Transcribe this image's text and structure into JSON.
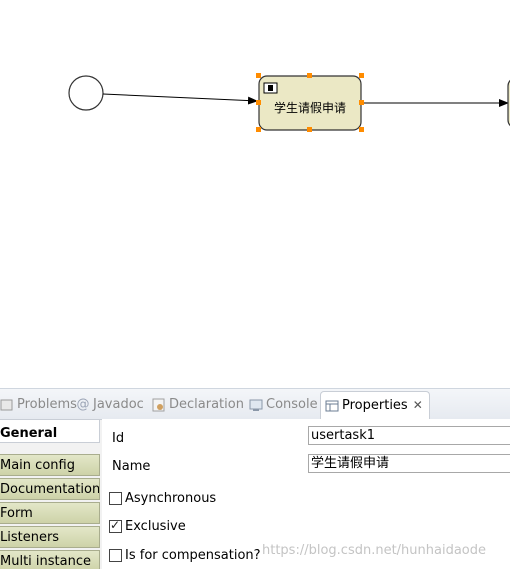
{
  "diagram": {
    "task_label": "学生请假申请"
  },
  "tabs": [
    {
      "label": "Problems",
      "icon": "problems-icon",
      "active": false
    },
    {
      "label": "Javadoc",
      "icon": "at-icon",
      "active": false
    },
    {
      "label": "Declaration",
      "icon": "declaration-icon",
      "active": false
    },
    {
      "label": "Console",
      "icon": "console-icon",
      "active": false
    },
    {
      "label": "Properties",
      "icon": "properties-icon",
      "active": true
    }
  ],
  "sidebar": {
    "items": [
      {
        "label": "General"
      },
      {
        "label": "Main config"
      },
      {
        "label": "Documentation"
      },
      {
        "label": "Form"
      },
      {
        "label": "Listeners"
      },
      {
        "label": "Multi instance"
      }
    ]
  },
  "general": {
    "id_label": "Id",
    "id_value": "usertask1",
    "name_label": "Name",
    "name_value": "学生请假申请",
    "asynchronous_label": "Asynchronous",
    "asynchronous_checked": false,
    "exclusive_label": "Exclusive",
    "exclusive_checked": true,
    "compensation_label": "Is for compensation?",
    "compensation_checked": false
  },
  "watermark": "https://blog.csdn.net/hunhaidaode",
  "colors": {
    "task_fill": "#ebe8c5",
    "handle": "#ff8c00",
    "sidebar_btn": "#d8dcb8"
  }
}
